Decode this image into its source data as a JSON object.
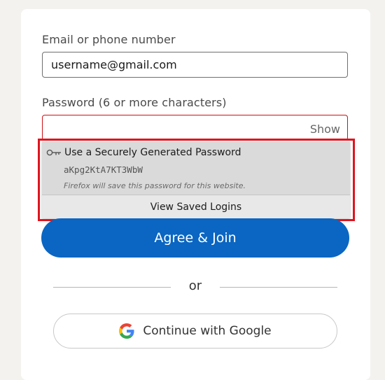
{
  "form": {
    "email_label": "Email or phone number",
    "email_value": "username@gmail.com",
    "password_label": "Password (6 or more characters)",
    "password_value": "",
    "show_label": "Show"
  },
  "autofill": {
    "title": "Use a Securely Generated Password",
    "generated_password": "aKpg2KtA7KT3WbW",
    "note": "Firefox will save this password for this website.",
    "view_logins_label": "View Saved Logins",
    "icon": "key-icon"
  },
  "actions": {
    "join_label": "Agree & Join",
    "or_label": "or",
    "google_label": "Continue with Google",
    "google_icon": "google-icon"
  },
  "colors": {
    "primary": "#0a66c2",
    "error_border": "#cc1016",
    "highlight": "#e0141e"
  }
}
